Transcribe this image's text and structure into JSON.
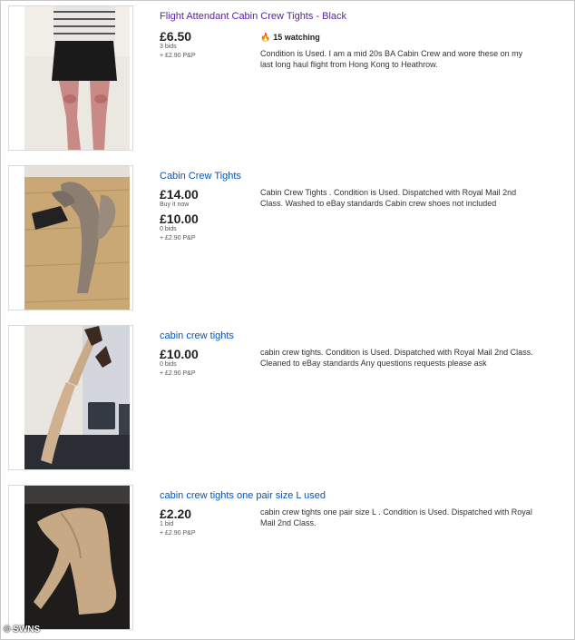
{
  "listings": [
    {
      "title": "Flight Attendant Cabin Crew Tights - Black",
      "price": "£6.50",
      "bids": "3 bids",
      "postage": "+ £2.90 P&P",
      "watching": "15 watching",
      "description": "Condition is Used. I am a mid 20s BA Cabin Crew and wore these on my last long haul flight from Hong Kong to Heathrow."
    },
    {
      "title": "Cabin Crew Tights",
      "buy_it_now_price": "£14.00",
      "buy_it_now_label": "Buy it now",
      "price": "£10.00",
      "bids": "0 bids",
      "postage": "+ £2.90 P&P",
      "description": "Cabin Crew Tights . Condition is Used. Dispatched with Royal Mail 2nd Class. Washed to eBay standards Cabin crew shoes not included"
    },
    {
      "title": "cabin crew tights",
      "price": "£10.00",
      "bids": "0 bids",
      "postage": "+ £2.90 P&P",
      "description": "cabin crew tights. Condition is Used. Dispatched with Royal Mail 2nd Class. Cleaned to eBay standards Any questions requests please ask"
    },
    {
      "title": "cabin crew tights one pair size  L used",
      "price": "£2.20",
      "bids": "1 bid",
      "postage": "+ £2.90 P&P",
      "description": "cabin crew tights one pair size  L . Condition is Used. Dispatched with Royal Mail 2nd Class."
    }
  ],
  "watermark": "© SWNS",
  "colors": {
    "link": "#0654ba",
    "visited_link": "#5c1fa0",
    "watch_flame": "#f7931e"
  }
}
